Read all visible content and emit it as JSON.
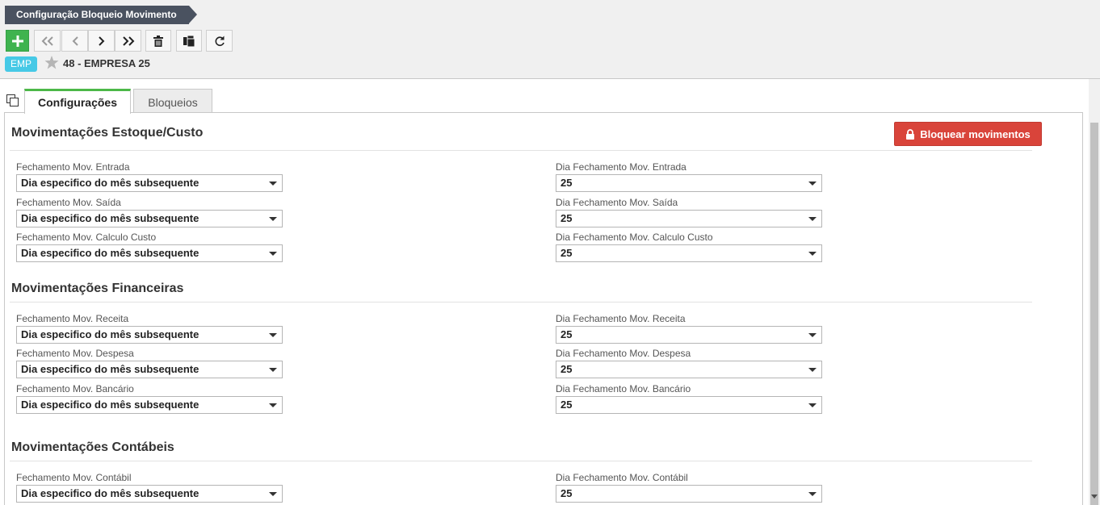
{
  "header": {
    "breadcrumb": "Configuração Bloqueio Movimento",
    "company_badge": "EMP",
    "company_name": "48 - EMPRESA 25"
  },
  "toolbar": {
    "buttons": [
      "plus-icon",
      "first-record-icon",
      "previous-record-icon",
      "next-record-icon",
      "last-record-icon",
      "trash-icon",
      "copy-icon",
      "refresh-icon"
    ]
  },
  "tabs": [
    {
      "label": "Configurações",
      "active": true
    },
    {
      "label": "Bloqueios",
      "active": false
    }
  ],
  "actions": {
    "lock_label": "Bloquear movimentos"
  },
  "colors": {
    "accent_green": "#3fb34f",
    "danger_red": "#d9443a",
    "badge_cyan": "#46c9e6",
    "breadcrumb_dark": "#4a5260"
  },
  "sections": [
    {
      "title": "Movimentações Estoque/Custo",
      "fields": [
        {
          "label": "Fechamento Mov. Entrada",
          "value": "Dia especifico do mês subsequente",
          "day_label": "Dia Fechamento Mov. Entrada",
          "day_value": "25"
        },
        {
          "label": "Fechamento Mov. Saída",
          "value": "Dia especifico do mês subsequente",
          "day_label": "Dia Fechamento Mov. Saída",
          "day_value": "25"
        },
        {
          "label": "Fechamento Mov. Calculo Custo",
          "value": "Dia especifico do mês subsequente",
          "day_label": "Dia Fechamento Mov. Calculo Custo",
          "day_value": "25"
        }
      ]
    },
    {
      "title": "Movimentações Financeiras",
      "fields": [
        {
          "label": "Fechamento Mov. Receita",
          "value": "Dia especifico do mês subsequente",
          "day_label": "Dia Fechamento Mov. Receita",
          "day_value": "25"
        },
        {
          "label": "Fechamento Mov. Despesa",
          "value": "Dia especifico do mês subsequente",
          "day_label": "Dia Fechamento Mov. Despesa",
          "day_value": "25"
        },
        {
          "label": "Fechamento Mov. Bancário",
          "value": "Dia especifico do mês subsequente",
          "day_label": "Dia Fechamento Mov. Bancário",
          "day_value": "25"
        }
      ]
    },
    {
      "title": "Movimentações Contábeis",
      "fields": [
        {
          "label": "Fechamento Mov. Contábil",
          "value": "Dia especifico do mês subsequente",
          "day_label": "Dia Fechamento Mov. Contábil",
          "day_value": "25"
        }
      ]
    }
  ]
}
